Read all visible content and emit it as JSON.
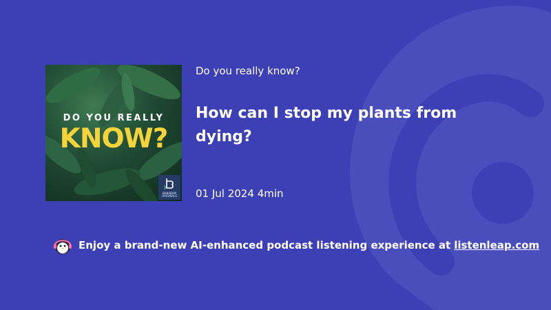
{
  "episode": {
    "show_name": "Do you really know?",
    "title": "How can I stop my plants from dying?",
    "date": "01 Jul 2024",
    "duration": "4min"
  },
  "cover": {
    "line1": "DO YOU REALLY",
    "line2": "KNOW?",
    "badge_text": "BABABAM ORIGINALS"
  },
  "promo": {
    "text": "Enjoy a brand-new AI-enhanced podcast listening experience at",
    "link_text": "listenleap.com"
  },
  "icons": {
    "background": "listenleap-watermark-icon",
    "mascot": "penguin-headphones-icon",
    "badge": "bababam-logo-icon"
  },
  "colors": {
    "background": "#3d40b5",
    "accent_yellow": "#f5d33a",
    "text": "#ffffff"
  }
}
